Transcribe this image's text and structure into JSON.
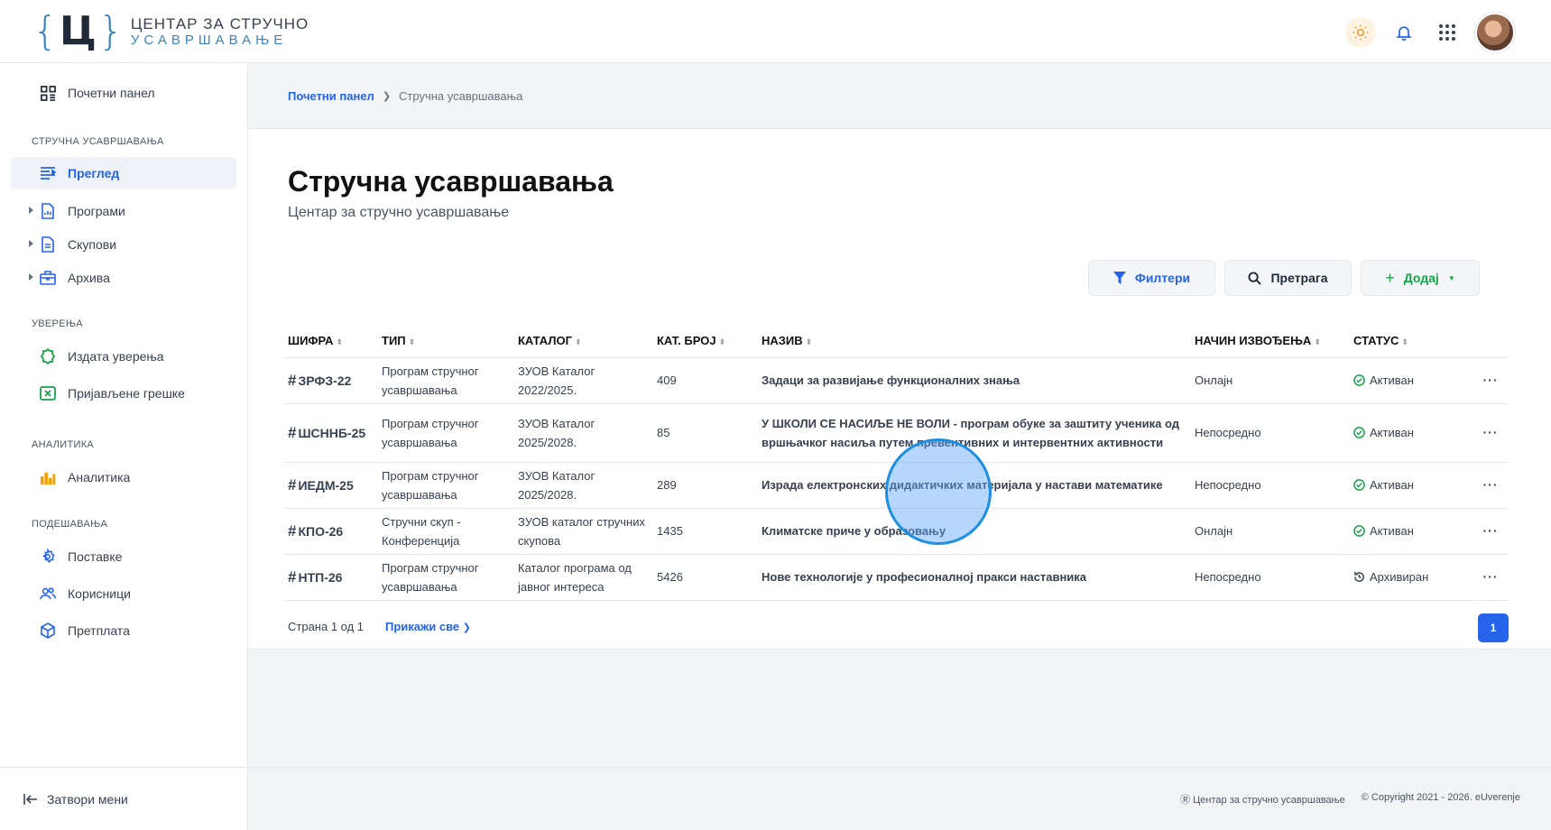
{
  "header": {
    "logo": {
      "letter": "Ц",
      "line1": "ЦЕНТАР ЗА СТРУЧНО",
      "line2": "УСАВРШАВАЊЕ"
    },
    "icons": [
      "sun-icon",
      "bell-icon",
      "apps-grid-icon",
      "avatar"
    ]
  },
  "sidebar": {
    "dashboard": "Почетни панел",
    "sections": [
      {
        "title": "СТРУЧНА УСАВРШАВАЊА",
        "items": [
          "Преглед",
          "Програми",
          "Скупови",
          "Архива"
        ]
      },
      {
        "title": "УВЕРЕЊА",
        "items": [
          "Издата уверења",
          "Пријављене грешке"
        ]
      },
      {
        "title": "АНАЛИТИКА",
        "items": [
          "Аналитика"
        ]
      },
      {
        "title": "ПОДЕШАВАЊА",
        "items": [
          "Поставке",
          "Корисници",
          "Претплата"
        ]
      }
    ],
    "close_menu": "Затвори мени"
  },
  "breadcrumb": {
    "home": "Почетни панел",
    "current": "Стручна усавршавања"
  },
  "page": {
    "title": "Стручна усавршавања",
    "subtitle": "Центар за стручно усавршавање"
  },
  "toolbar": {
    "filters": "Филтери",
    "search": "Претрага",
    "add": "Додај"
  },
  "table": {
    "columns": [
      "ШИФРА",
      "ТИП",
      "КАТАЛОГ",
      "КАТ. БРОЈ",
      "НАЗИВ",
      "НАЧИН ИЗВОЂЕЊА",
      "СТАТУС"
    ],
    "rows": [
      {
        "code": "ЗРФЗ-22",
        "type": "Програм стручног усавршавања",
        "catalog": "ЗУОВ Каталог 2022/2025.",
        "num": "409",
        "title": "Задаци за развијање функционалних знања",
        "mode": "Онлајн",
        "status": "Активан"
      },
      {
        "code": "ШСННБ-25",
        "type": "Програм стручног усавршавања",
        "catalog": "ЗУОВ Каталог 2025/2028.",
        "num": "85",
        "title": "У ШКОЛИ СЕ НАСИЉЕ НЕ ВОЛИ - програм обуке за заштиту ученика од вршњачког насиља путем превентивних и интервентних активности",
        "mode": "Непосредно",
        "status": "Активан"
      },
      {
        "code": "ИЕДМ-25",
        "type": "Програм стручног усавршавања",
        "catalog": "ЗУОВ Каталог 2025/2028.",
        "num": "289",
        "title": "Израда електронских дидактичких материјала у настави математике",
        "mode": "Непосредно",
        "status": "Активан"
      },
      {
        "code": "КПО-26",
        "type": "Стручни скуп - Конференција",
        "catalog": "ЗУОВ каталог стручних скупова",
        "num": "1435",
        "title": "Климатске приче у образовању",
        "mode": "Онлајн",
        "status": "Активан"
      },
      {
        "code": "НТП-26",
        "type": "Програм стручног усавршавања",
        "catalog": "Каталог програма од јавног интереса",
        "num": "5426",
        "title": "Нове технологије у професионалној пракси наставника",
        "mode": "Непосредно",
        "status": "Архивиран"
      }
    ]
  },
  "pagination": {
    "info": "Страна 1 од 1",
    "show_all": "Прикажи све",
    "current": "1"
  },
  "footer": {
    "org": "Центар за стручно усавршавање",
    "copyright": "Copyright 2021 - 2026. eUverenje"
  },
  "colors": {
    "accent": "#2563eb",
    "success": "#16a34a",
    "logo_blue": "#3b82c4"
  }
}
